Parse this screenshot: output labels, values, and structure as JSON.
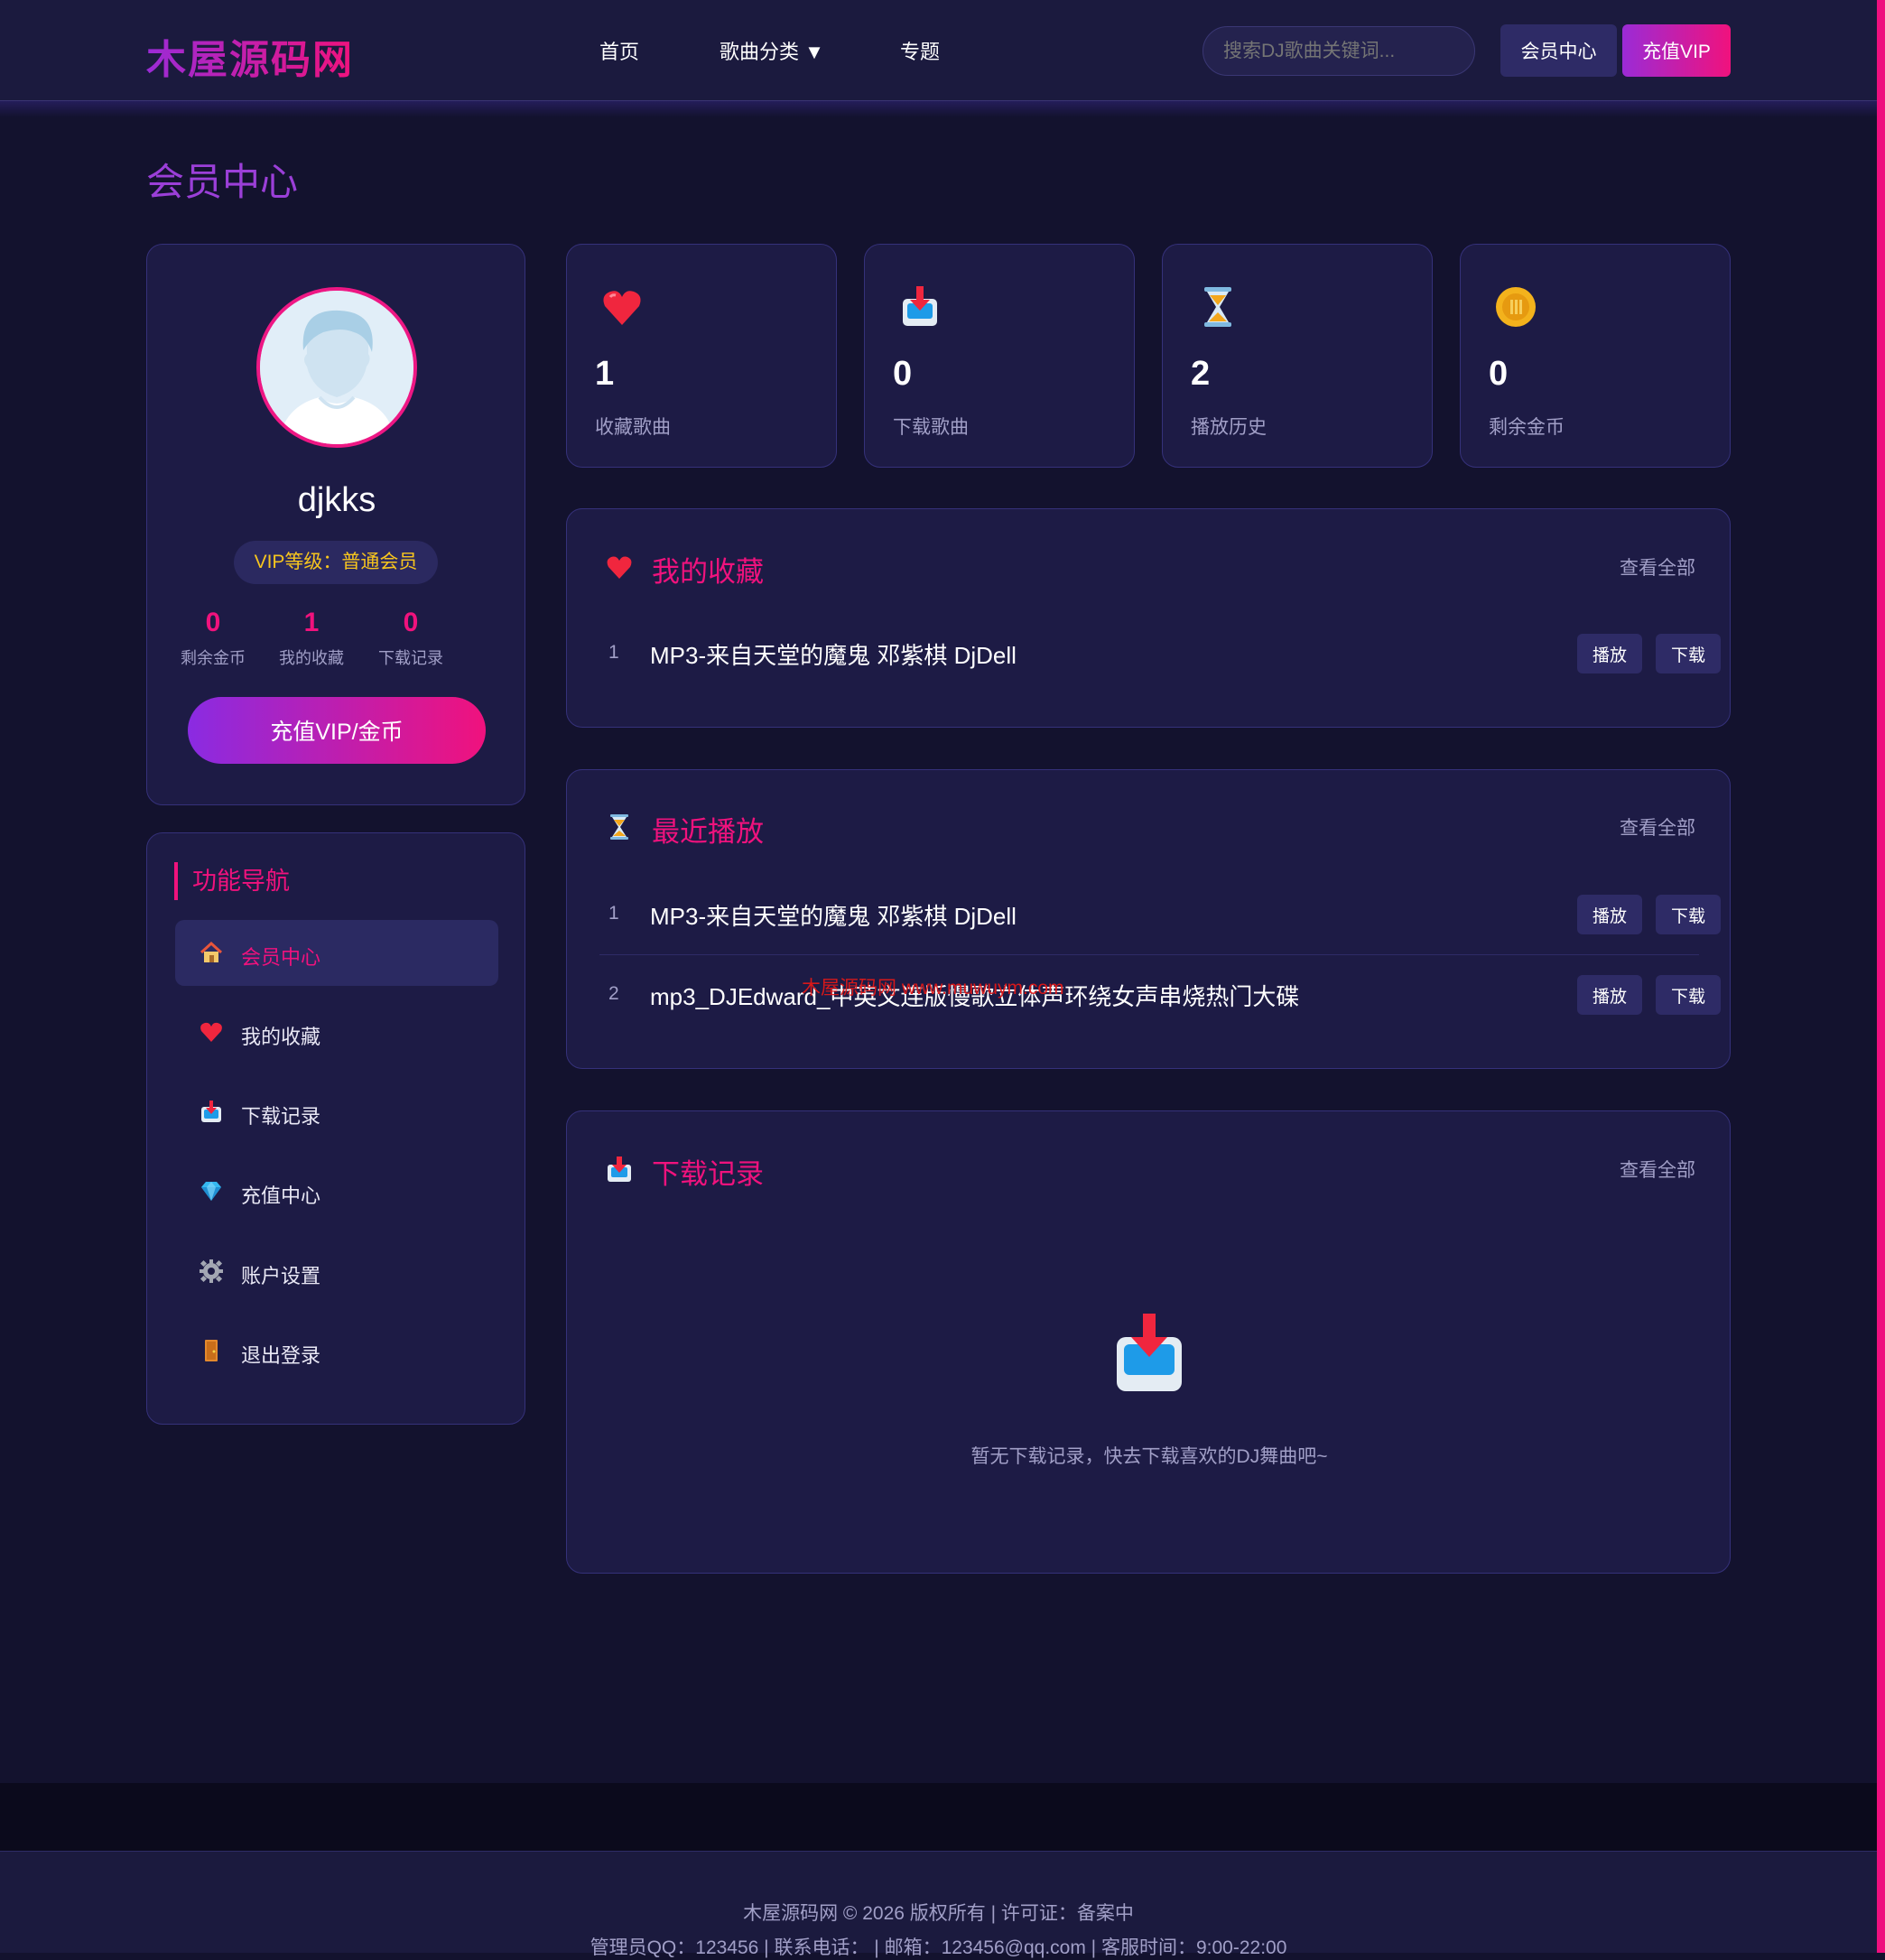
{
  "header": {
    "logo": "木屋源码网",
    "nav": {
      "home": "首页",
      "category": "歌曲分类 ▼",
      "topics": "专题"
    },
    "search_placeholder": "搜索DJ歌曲关键词...",
    "member_button": "会员中心",
    "vip_button": "充值VIP"
  },
  "page_title": "会员中心",
  "profile": {
    "username": "djkks",
    "vip_level": "VIP等级：普通会员",
    "stats": [
      {
        "value": "0",
        "label": "剩余金币"
      },
      {
        "value": "1",
        "label": "我的收藏"
      },
      {
        "value": "0",
        "label": "下载记录"
      }
    ],
    "recharge_button": "充值VIP/金币"
  },
  "side_nav": {
    "title": "功能导航",
    "items": [
      {
        "label": "会员中心",
        "icon": "house-icon",
        "active": true
      },
      {
        "label": "我的收藏",
        "icon": "heart-icon"
      },
      {
        "label": "下载记录",
        "icon": "download-tray-icon"
      },
      {
        "label": "充值中心",
        "icon": "diamond-icon"
      },
      {
        "label": "账户设置",
        "icon": "gear-icon"
      },
      {
        "label": "退出登录",
        "icon": "door-icon"
      }
    ]
  },
  "stat_cards": [
    {
      "value": "1",
      "label": "收藏歌曲",
      "icon": "heart-icon"
    },
    {
      "value": "0",
      "label": "下载歌曲",
      "icon": "download-tray-icon"
    },
    {
      "value": "2",
      "label": "播放历史",
      "icon": "hourglass-icon"
    },
    {
      "value": "0",
      "label": "剩余金币",
      "icon": "coin-icon"
    }
  ],
  "favorites": {
    "title": "我的收藏",
    "view_all": "查看全部",
    "songs": [
      {
        "index": "1",
        "name": "MP3-来自天堂的魔鬼 邓紫棋 DjDell",
        "play": "播放",
        "download": "下载"
      }
    ]
  },
  "recent": {
    "title": "最近播放",
    "view_all": "查看全部",
    "songs": [
      {
        "index": "1",
        "name": "MP3-来自天堂的魔鬼 邓紫棋 DjDell",
        "play": "播放",
        "download": "下载"
      },
      {
        "index": "2",
        "name": "mp3_DJEdward_中英文连版慢歌立体声环绕女声串烧热门大碟",
        "play": "播放",
        "download": "下载"
      }
    ]
  },
  "downloads": {
    "title": "下载记录",
    "view_all": "查看全部",
    "empty_text": "暂无下载记录，快去下载喜欢的DJ舞曲吧~"
  },
  "watermark": "木屋源码网 www.muwuym.com",
  "footer": {
    "line1": "木屋源码网 © 2026 版权所有 | 许可证：备案中",
    "line2": "管理员QQ：123456 | 联系电话： | 邮箱：123456@qq.com | 客服时间：9:00-22:00"
  },
  "colors": {
    "accent": "#f0127d",
    "purple": "#9b2bd6",
    "gold": "#f7c51e",
    "bg": "#13122e",
    "card": "#1d1b45"
  }
}
